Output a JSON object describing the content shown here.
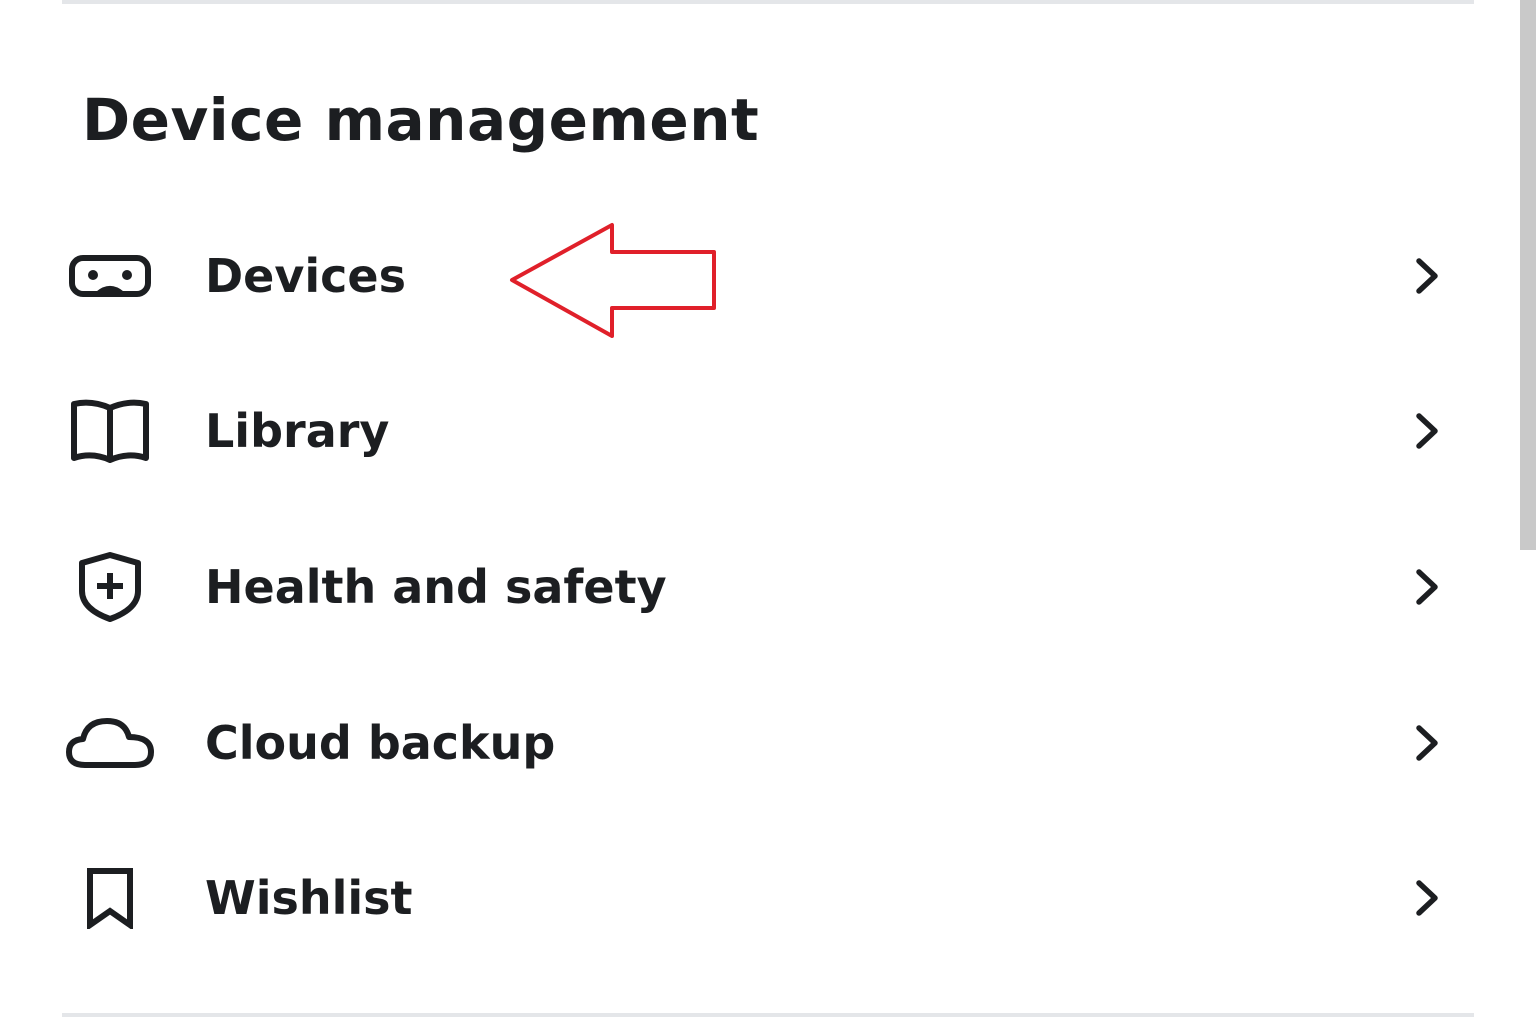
{
  "section": {
    "title": "Device management"
  },
  "menu": {
    "items": [
      {
        "label": "Devices",
        "icon": "vr-headset-icon"
      },
      {
        "label": "Library",
        "icon": "book-icon"
      },
      {
        "label": "Health and safety",
        "icon": "shield-plus-icon"
      },
      {
        "label": "Cloud backup",
        "icon": "cloud-icon"
      },
      {
        "label": "Wishlist",
        "icon": "bookmark-icon"
      }
    ],
    "chevron_icon": "chevron-right-icon"
  },
  "annotation": {
    "color": "#e0202a",
    "shape": "arrow-left",
    "points_to": "Devices"
  },
  "colors": {
    "text": "#1c1e21",
    "divider": "#e4e6e9",
    "scrollbar_thumb": "#c9c9c9",
    "background": "#ffffff"
  }
}
